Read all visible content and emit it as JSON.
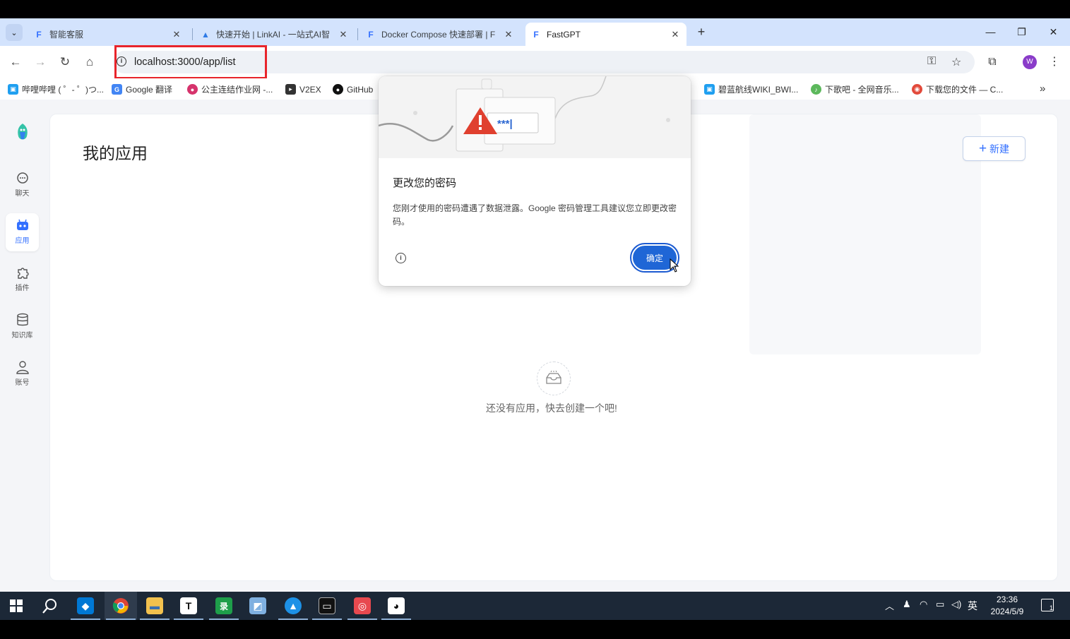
{
  "browser": {
    "tabs": [
      {
        "title": "智能客服",
        "active": false
      },
      {
        "title": "快速开始 | LinkAI - 一站式AI智",
        "active": false
      },
      {
        "title": "Docker Compose 快速部署 | F",
        "active": false
      },
      {
        "title": "FastGPT",
        "active": true
      }
    ],
    "url": "localhost:3000/app/list",
    "profile_initial": "W",
    "bookmarks": [
      {
        "label": "哔哩哔哩 ( ゜- ゜)つ...",
        "color": "#1f9ff0"
      },
      {
        "label": "Google 翻译",
        "color": "#4285f4"
      },
      {
        "label": "公主连结作业网 -...",
        "color": "#d6336c"
      },
      {
        "label": "V2EX",
        "color": "#333333"
      },
      {
        "label": "GitHub",
        "color": "#111111"
      },
      {
        "label": "碧蓝航线WIKI_BWI...",
        "color": "#1f9ff0"
      },
      {
        "label": "下歌吧 - 全网音乐...",
        "color": "#5cb85c"
      },
      {
        "label": "下载您的文件 — C...",
        "color": "#e24a3b"
      }
    ]
  },
  "sidebar": {
    "items": [
      {
        "label": "聊天",
        "icon": "chat-icon",
        "active": false
      },
      {
        "label": "应用",
        "icon": "robot-icon",
        "active": true
      },
      {
        "label": "插件",
        "icon": "puzzle-icon",
        "active": false
      },
      {
        "label": "知识库",
        "icon": "database-icon",
        "active": false
      },
      {
        "label": "账号",
        "icon": "user-icon",
        "active": false
      }
    ]
  },
  "main": {
    "title": "我的应用",
    "new_button": "新建",
    "empty_text": "还没有应用，快去创建一个吧!"
  },
  "popup": {
    "title": "更改您的密码",
    "message": "您刚才使用的密码遭遇了数据泄露。Google 密码管理工具建议您立即更改密码。",
    "ok_button": "确定",
    "art_text": "***|"
  },
  "taskbar": {
    "apps": [
      {
        "name": "vscode",
        "glyph": "◆",
        "color": "#0078d4"
      },
      {
        "name": "chrome",
        "glyph": "●",
        "color": "#db4437"
      },
      {
        "name": "file-explorer",
        "glyph": "▬",
        "color": "#f2c14e"
      },
      {
        "name": "typora",
        "glyph": "T",
        "color": "#ffffff"
      },
      {
        "name": "recorder",
        "glyph": "录",
        "color": "#1e9e4a"
      },
      {
        "name": "notes",
        "glyph": "◩",
        "color": "#7fb0e0"
      },
      {
        "name": "docker",
        "glyph": "▲",
        "color": "#1d91e6"
      },
      {
        "name": "terminal",
        "glyph": "▭",
        "color": "#111111"
      },
      {
        "name": "netease-music",
        "glyph": "◎",
        "color": "#e8494f"
      },
      {
        "name": "qq",
        "glyph": "◕",
        "color": "#ffffff"
      }
    ],
    "ime": "英",
    "time": "23:36",
    "date": "2024/5/9",
    "notification_count": "1"
  },
  "colors": {
    "accent": "#3370ff",
    "popup_button": "#1f66d6",
    "highlight_box": "#e8242b"
  }
}
